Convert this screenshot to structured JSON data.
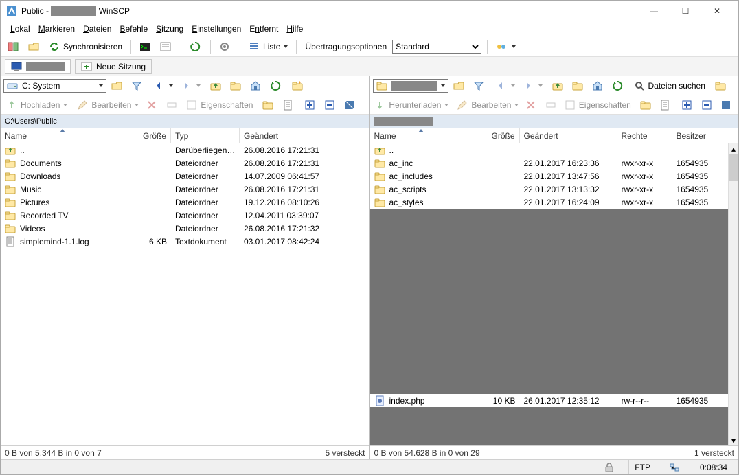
{
  "window": {
    "title_prefix": "Public - ",
    "title_suffix": "WinSCP"
  },
  "menu": [
    "Lokal",
    "Markieren",
    "Dateien",
    "Befehle",
    "Sitzung",
    "Einstellungen",
    "Entfernt",
    "Hilfe"
  ],
  "toolbar1": {
    "sync": "Synchronisieren",
    "list": "Liste",
    "transfer_label": "Übertragungsoptionen",
    "transfer_value": "Standard"
  },
  "session": {
    "new": "Neue Sitzung"
  },
  "left": {
    "drive": "C: System",
    "upload": "Hochladen",
    "edit": "Bearbeiten",
    "props": "Eigenschaften",
    "path": "C:\\Users\\Public",
    "cols": {
      "name": "Name",
      "size": "Größe",
      "type": "Typ",
      "changed": "Geändert"
    },
    "rows": [
      {
        "icon": "up",
        "name": "..",
        "size": "",
        "type": "Darüberliegendes ...",
        "changed": "26.08.2016  17:21:31"
      },
      {
        "icon": "folder",
        "name": "Documents",
        "size": "",
        "type": "Dateiordner",
        "changed": "26.08.2016  17:21:31"
      },
      {
        "icon": "folder",
        "name": "Downloads",
        "size": "",
        "type": "Dateiordner",
        "changed": "14.07.2009  06:41:57"
      },
      {
        "icon": "folder",
        "name": "Music",
        "size": "",
        "type": "Dateiordner",
        "changed": "26.08.2016  17:21:31"
      },
      {
        "icon": "folder",
        "name": "Pictures",
        "size": "",
        "type": "Dateiordner",
        "changed": "19.12.2016  08:10:26"
      },
      {
        "icon": "folder",
        "name": "Recorded TV",
        "size": "",
        "type": "Dateiordner",
        "changed": "12.04.2011  03:39:07"
      },
      {
        "icon": "folder",
        "name": "Videos",
        "size": "",
        "type": "Dateiordner",
        "changed": "26.08.2016  17:21:32"
      },
      {
        "icon": "file",
        "name": "simplemind-1.1.log",
        "size": "6 KB",
        "type": "Textdokument",
        "changed": "03.01.2017  08:42:24"
      }
    ],
    "status_left": "0 B von 5.344 B in 0 von 7",
    "status_right": "5 versteckt"
  },
  "right": {
    "download": "Herunterladen",
    "edit": "Bearbeiten",
    "props": "Eigenschaften",
    "search": "Dateien suchen",
    "cols": {
      "name": "Name",
      "size": "Größe",
      "changed": "Geändert",
      "rights": "Rechte",
      "owner": "Besitzer"
    },
    "rows": [
      {
        "icon": "up",
        "name": "..",
        "size": "",
        "changed": "",
        "rights": "",
        "owner": ""
      },
      {
        "icon": "folder",
        "name": "ac_inc",
        "size": "",
        "changed": "22.01.2017 16:23:36",
        "rights": "rwxr-xr-x",
        "owner": "1654935"
      },
      {
        "icon": "folder",
        "name": "ac_includes",
        "size": "",
        "changed": "22.01.2017 13:47:56",
        "rights": "rwxr-xr-x",
        "owner": "1654935"
      },
      {
        "icon": "folder",
        "name": "ac_scripts",
        "size": "",
        "changed": "22.01.2017 13:13:32",
        "rights": "rwxr-xr-x",
        "owner": "1654935"
      },
      {
        "icon": "folder",
        "name": "ac_styles",
        "size": "",
        "changed": "22.01.2017 16:24:09",
        "rights": "rwxr-xr-x",
        "owner": "1654935"
      }
    ],
    "file_row": {
      "icon": "php",
      "name": "index.php",
      "size": "10 KB",
      "changed": "26.01.2017 12:35:12",
      "rights": "rw-r--r--",
      "owner": "1654935"
    },
    "status_left": "0 B von 54.628 B in 0 von 29",
    "status_right": "1 versteckt"
  },
  "bottom": {
    "proto": "FTP",
    "time": "0:08:34"
  }
}
